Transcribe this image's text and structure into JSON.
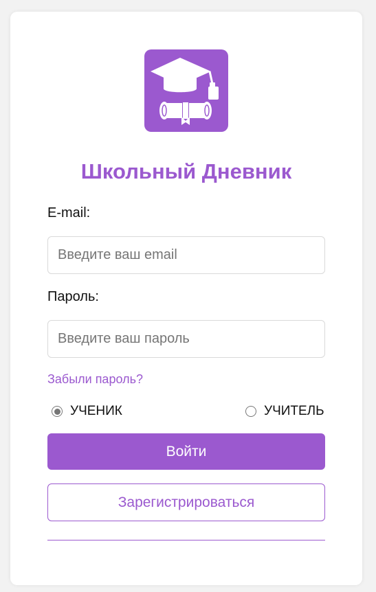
{
  "app": {
    "title": "Школьный Дневник",
    "logo_icon": "graduation-cap-diploma-icon",
    "accent_color": "#9b59cf"
  },
  "form": {
    "email_label": "E-mail:",
    "email_placeholder": "Введите ваш email",
    "email_value": "",
    "password_label": "Пароль:",
    "password_placeholder": "Введите ваш пароль",
    "password_value": "",
    "forgot_link": "Забыли пароль?",
    "roles": [
      {
        "label": "УЧЕНИК",
        "selected": true
      },
      {
        "label": "УЧИТЕЛЬ",
        "selected": false
      }
    ],
    "login_button": "Войти",
    "register_button": "Зарегистрироваться"
  }
}
